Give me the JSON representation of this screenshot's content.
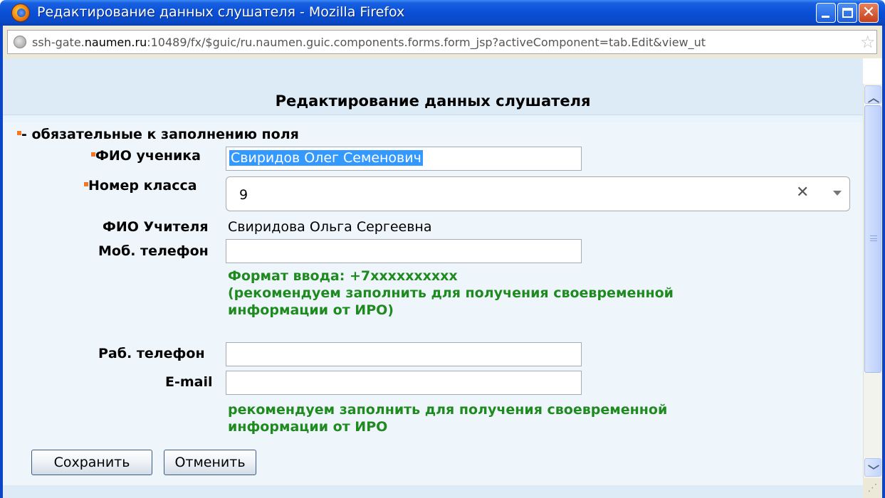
{
  "window": {
    "title": "Редактирование данных слушателя - Mozilla Firefox",
    "url_prefix": "ssh-gate.",
    "url_domain": "naumen.ru",
    "url_rest": ":10489/fx/$guic/ru.naumen.guic.components.forms.form_jsp?activeComponent=tab.Edit&view_ut"
  },
  "form": {
    "heading": "Редактирование данных слушателя",
    "legend": "- обязательные к заполнению поля",
    "student_name": {
      "label": "ФИО ученика",
      "value": "Свиридов Олег Семенович"
    },
    "class_number": {
      "label": "Номер класса",
      "value": "9"
    },
    "teacher": {
      "label": "ФИО Учителя",
      "value": "Свиридова Ольга Сергеевна"
    },
    "mobile_phone": {
      "label": "Моб. телефон",
      "value": "",
      "hint_line1": "Формат ввода: +7xxxxxxxxxx",
      "hint_line2": "(рекомендуем заполнить для получения своевременной",
      "hint_line3": "информации от ИРО)"
    },
    "work_phone": {
      "label": "Раб. телефон",
      "value": ""
    },
    "email": {
      "label": "E-mail",
      "value": "",
      "hint_line1": "рекомендуем заполнить для получения своевременной",
      "hint_line2": "информации от ИРО"
    },
    "save_label": "Сохранить",
    "cancel_label": "Отменить"
  },
  "colors": {
    "required_marker": "#f07828",
    "hint_text": "#1f8a1f",
    "titlebar": "#0a4fd6",
    "content_bg": "#eef6fc"
  },
  "icons": {
    "browser": "firefox-logo-icon",
    "site": "globe-icon",
    "bookmark": "star-icon",
    "clear": "clear-icon",
    "dropdown": "chevron-down-icon"
  }
}
